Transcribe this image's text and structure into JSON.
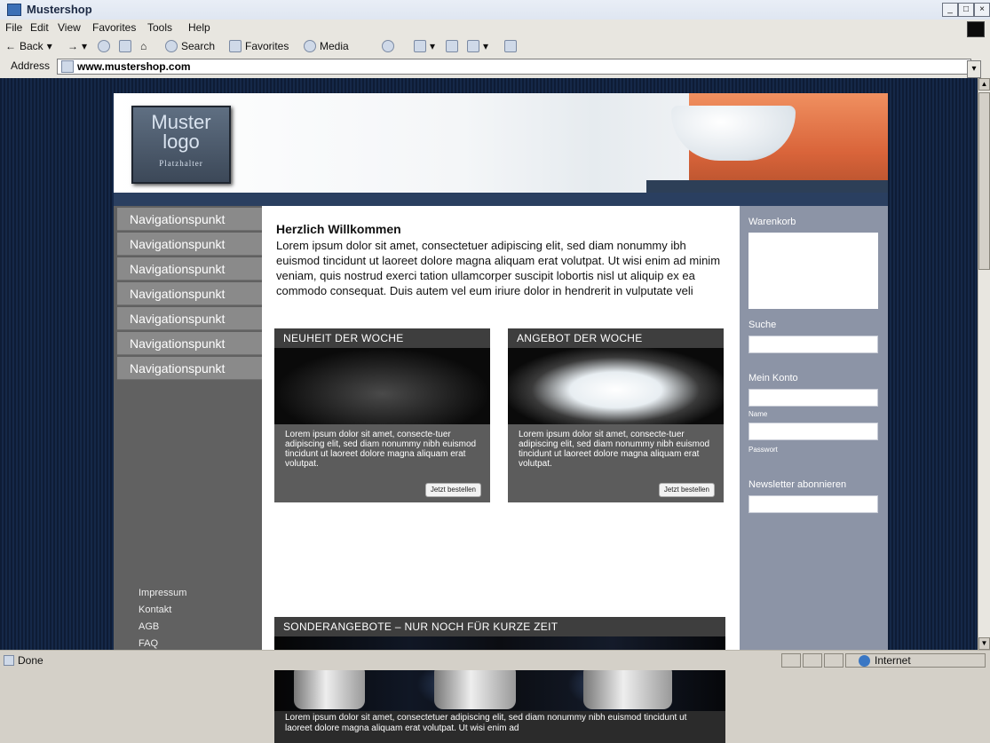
{
  "window": {
    "title": "Mustershop"
  },
  "menu": [
    "File",
    "Edit",
    "View",
    "Favorites",
    "Tools",
    "Help"
  ],
  "toolbar": {
    "back": "Back",
    "search": "Search",
    "favorites": "Favorites",
    "media": "Media"
  },
  "address": {
    "label": "Address",
    "url": "www.mustershop.com"
  },
  "site": {
    "logo": {
      "line1": "Muster",
      "line2": "logo",
      "line3": "Platzhalter"
    },
    "nav": [
      "Navigationspunkt",
      "Navigationspunkt",
      "Navigationspunkt",
      "Navigationspunkt",
      "Navigationspunkt",
      "Navigationspunkt",
      "Navigationspunkt"
    ],
    "footer_links": [
      "Impressum",
      "Kontakt",
      "AGB",
      "FAQ"
    ],
    "welcome": {
      "title": "Herzlich Willkommen",
      "text": "Lorem ipsum dolor sit amet, consectetuer adipiscing elit, sed diam nonummy ibh euismod tincidunt ut laoreet dolore magna aliquam erat volutpat. Ut wisi enim ad minim veniam, quis nostrud exerci tation ullamcorper suscipit lobortis nisl ut aliquip ex ea commodo consequat. Duis autem vel eum iriure dolor in hendrerit in vulputate veli"
    },
    "cards": [
      {
        "header": "NEUHEIT DER WOCHE",
        "text": "Lorem ipsum dolor sit amet, consecte-tuer adipiscing elit, sed diam nonummy nibh euismod tincidunt ut laoreet dolore magna aliquam erat volutpat.",
        "button": "Jetzt bestellen"
      },
      {
        "header": "ANGEBOT DER WOCHE",
        "text": "Lorem ipsum dolor sit amet, consecte-tuer adipiscing elit, sed diam nonummy nibh euismod tincidunt ut laoreet dolore magna aliquam erat volutpat.",
        "button": "Jetzt bestellen"
      }
    ],
    "special": {
      "header": "SONDERANGEBOTE – NUR NOCH FÜR KURZE ZEIT",
      "text": "Lorem ipsum dolor sit amet, consectetuer adipiscing elit, sed diam nonummy nibh euismod tincidunt ut laoreet dolore magna aliquam erat volutpat. Ut wisi enim ad"
    },
    "sidebar": {
      "cart": "Warenkorb",
      "search": "Suche",
      "account": "Mein Konto",
      "name_label": "Name",
      "password_label": "Passwort",
      "newsletter": "Newsletter abonnieren"
    }
  },
  "status": {
    "text": "Done",
    "zone": "Internet"
  }
}
